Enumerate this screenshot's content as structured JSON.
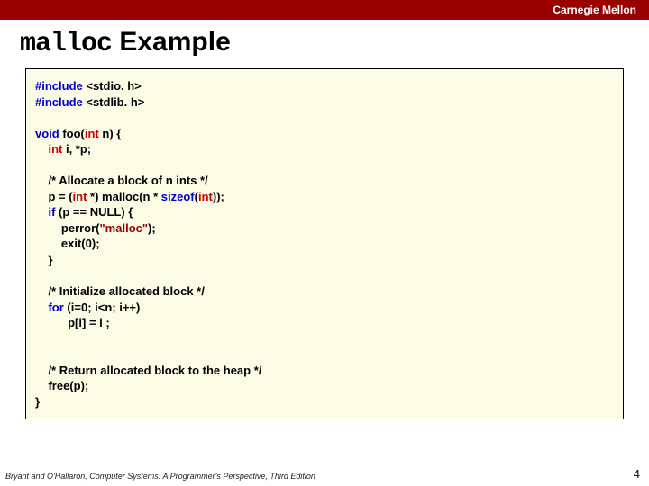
{
  "header": {
    "org": "Carnegie Mellon"
  },
  "title": {
    "mono": "malloc",
    "rest": " Example"
  },
  "code": {
    "inc1_kw": "#include ",
    "inc1_hdr": "<stdio. h>",
    "inc2_kw": "#include ",
    "inc2_hdr": "<stdlib. h>",
    "void": "void",
    "foo_name": " foo(",
    "int1": "int",
    "foo_arg": " n) {",
    "decl_pre": "    ",
    "int2": "int",
    "decl_rest": " i, *p;",
    "cmt1": "    /* Allocate a block of n ints */",
    "p_assign_pre": "    p = (",
    "int3": "int",
    "p_assign_mid": " *) malloc(n * ",
    "sizeof": "sizeof",
    "p_assign_paren": "(",
    "int4": "int",
    "p_assign_end": "));",
    "if_pre": "    ",
    "if": "if",
    "if_cond": " (p == NULL) {",
    "perror_pre": "        perror(",
    "perror_str": "\"malloc\"",
    "perror_end": ");",
    "exit_pre": "        exit(",
    "exit_num": "0",
    "exit_end": ");",
    "brace1": "    }",
    "cmt2": "    /* Initialize allocated block */",
    "for_pre": "    ",
    "for": "for",
    "for_open": " (i=",
    "zero1": "0",
    "for_rest": "; i<n; i++)",
    "loop_body": "          p[i] = i ;",
    "cmt3": "    /* Return allocated block to the heap */",
    "free": "    free(p);",
    "brace2": "}"
  },
  "footer": {
    "cite": "Bryant and O'Hallaron, Computer Systems: A Programmer's Perspective, Third Edition",
    "page": "4"
  }
}
